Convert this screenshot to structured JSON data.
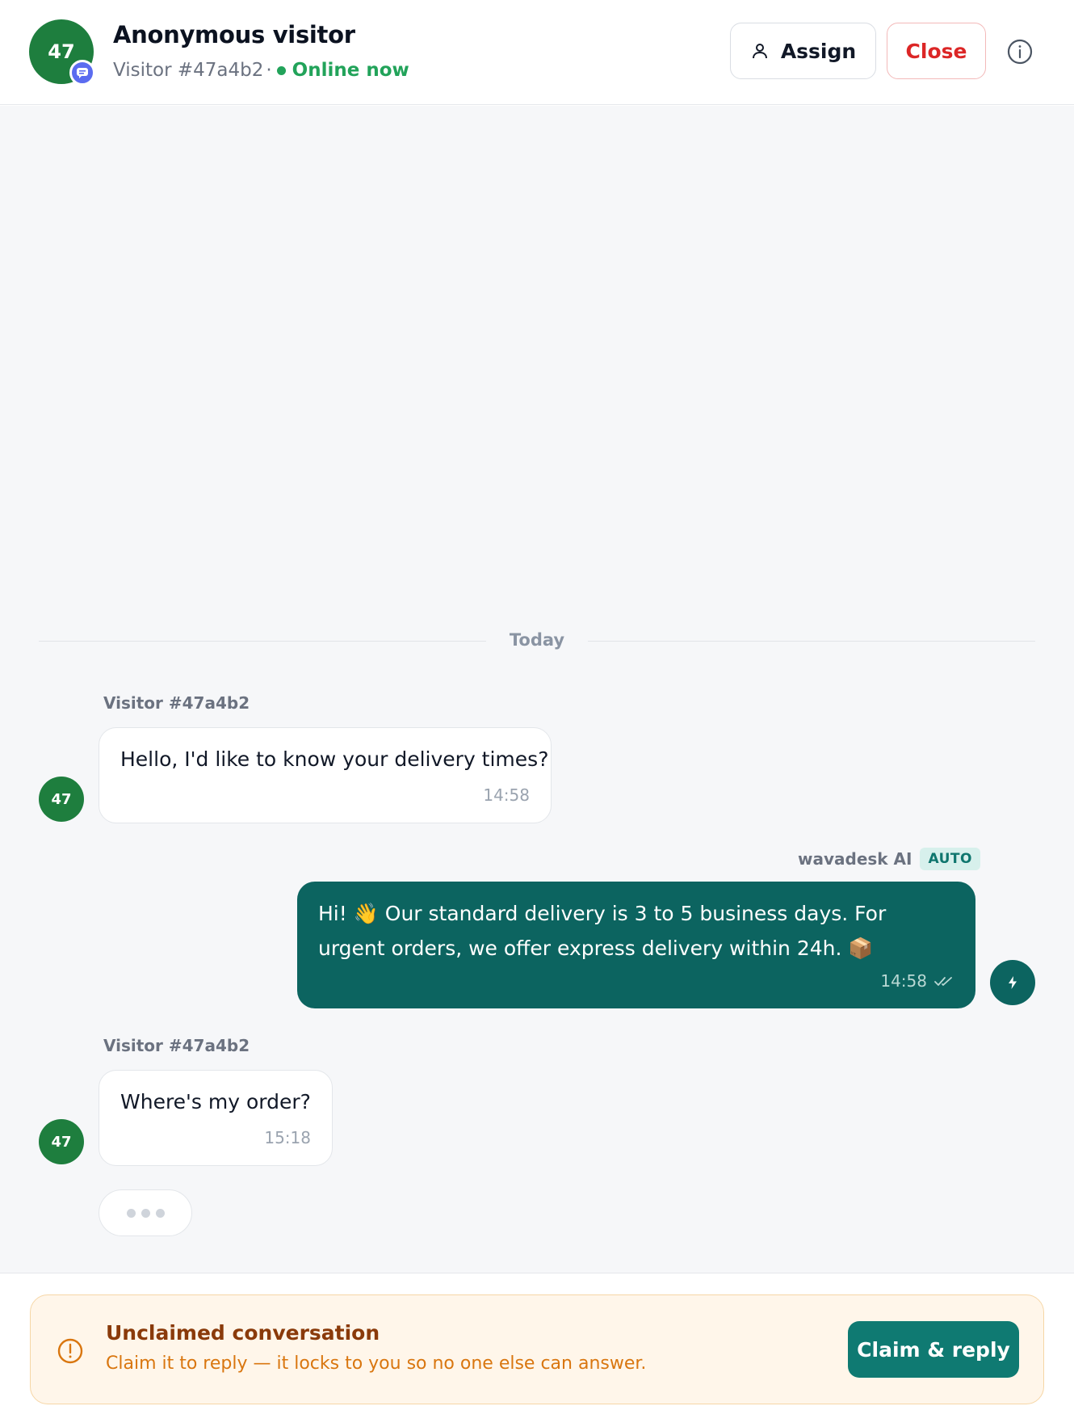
{
  "header": {
    "avatar_initials": "47",
    "visitor_name": "Anonymous visitor",
    "visitor_id": "Visitor #47a4b2",
    "separator": "·",
    "status": "Online now",
    "assign_label": "Assign",
    "close_label": "Close"
  },
  "chat": {
    "date_divider": "Today",
    "messages": [
      {
        "sender": "Visitor #47a4b2",
        "avatar": "47",
        "text": "Hello, I'd like to know your delivery times?",
        "time": "14:58"
      },
      {
        "sender": "wavadesk AI",
        "badge": "AUTO",
        "text": "Hi! 👋 Our standard delivery is 3 to 5 business days. For urgent orders, we offer express delivery within 24h. 📦",
        "time": "14:58"
      },
      {
        "sender": "Visitor #47a4b2",
        "avatar": "47",
        "text": "Where's my order?",
        "time": "15:18"
      }
    ]
  },
  "banner": {
    "title": "Unclaimed conversation",
    "text": "Claim it to reply — it locks to you so no one else can answer.",
    "claim_label": "Claim & reply"
  },
  "colors": {
    "brand_teal": "#0c6460",
    "avatar_green": "#1e7e3e",
    "online_green": "#22a35a",
    "close_red": "#dc2626",
    "warning_orange": "#d9760f"
  },
  "icons": [
    "chat-bubble-icon",
    "user-icon",
    "info-icon",
    "lightning-icon",
    "double-check-icon",
    "warning-icon"
  ]
}
